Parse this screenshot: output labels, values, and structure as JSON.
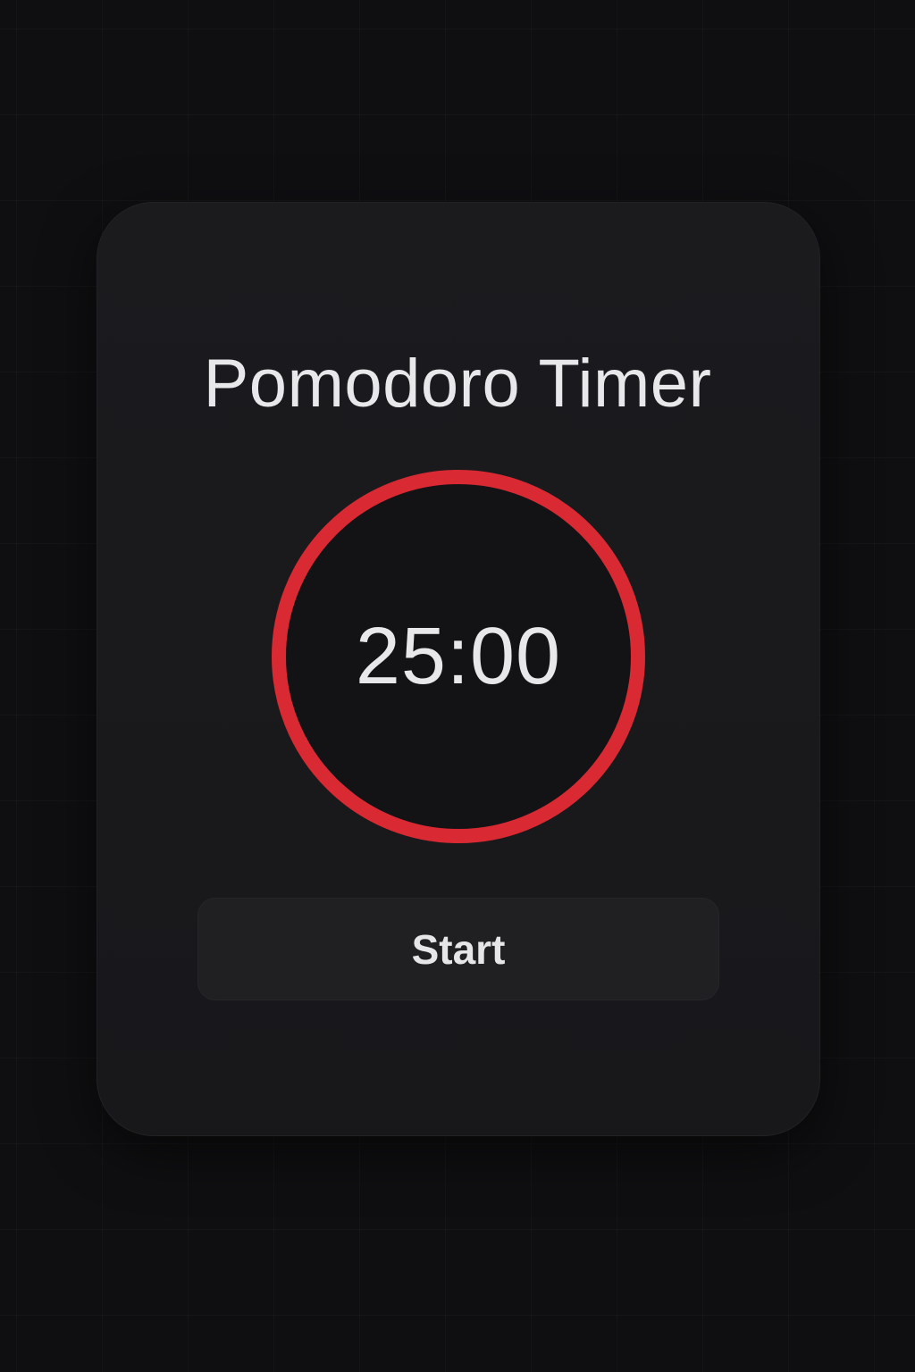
{
  "app": {
    "title": "Pomodoro Timer"
  },
  "timer": {
    "display": "25:00",
    "ring_color": "#d92932"
  },
  "controls": {
    "start_label": "Start"
  }
}
